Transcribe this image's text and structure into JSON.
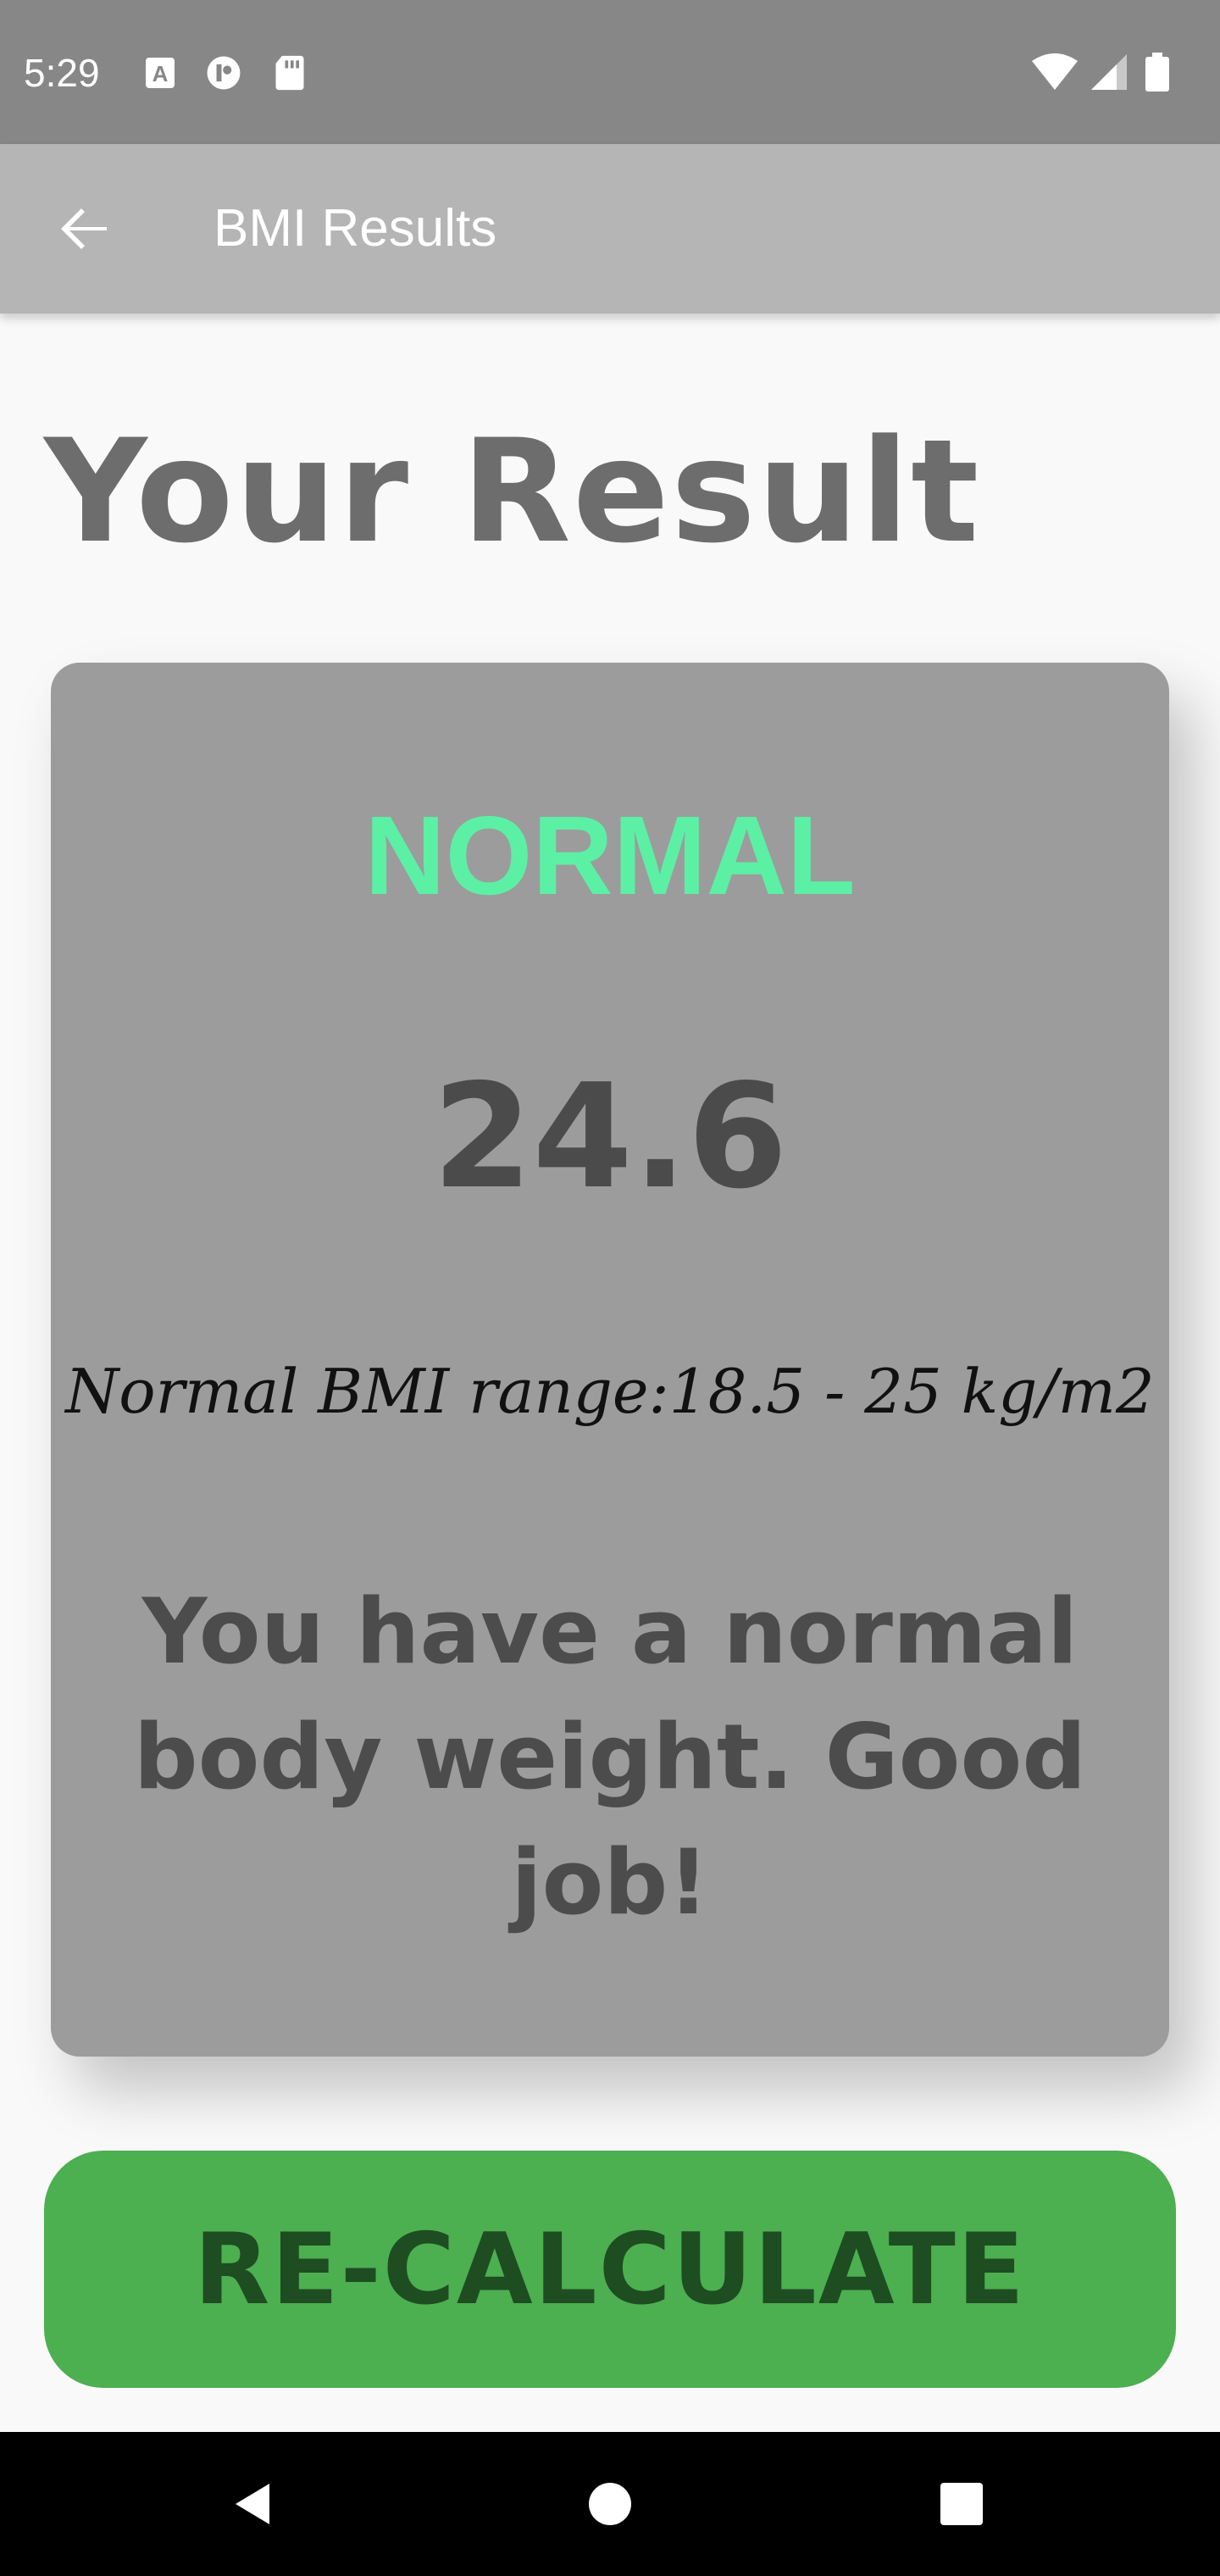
{
  "status_bar": {
    "time": "5:29",
    "icons_left": [
      "keyboard-a-icon",
      "data-saver-icon",
      "sd-card-icon"
    ],
    "icons_right": [
      "wifi-icon",
      "signal-icon",
      "battery-icon"
    ]
  },
  "app_bar": {
    "title": "BMI Results",
    "back_icon": "arrow-back-icon"
  },
  "page": {
    "title": "Your Result"
  },
  "result": {
    "status": "NORMAL",
    "bmi": "24.6",
    "range": "Normal BMI range:18.5 - 25 kg/m2",
    "message": "You have a normal body weight. Good job!"
  },
  "button": {
    "label": "RE-CALCULATE"
  },
  "nav": {
    "icons": [
      "back-triangle-icon",
      "home-circle-icon",
      "recents-square-icon"
    ]
  },
  "colors": {
    "status_bar": "#878787",
    "app_bar": "#b5b5b5",
    "card": "#9c9c9c",
    "status_text": "#5cf0a5",
    "button": "#4caf50"
  }
}
